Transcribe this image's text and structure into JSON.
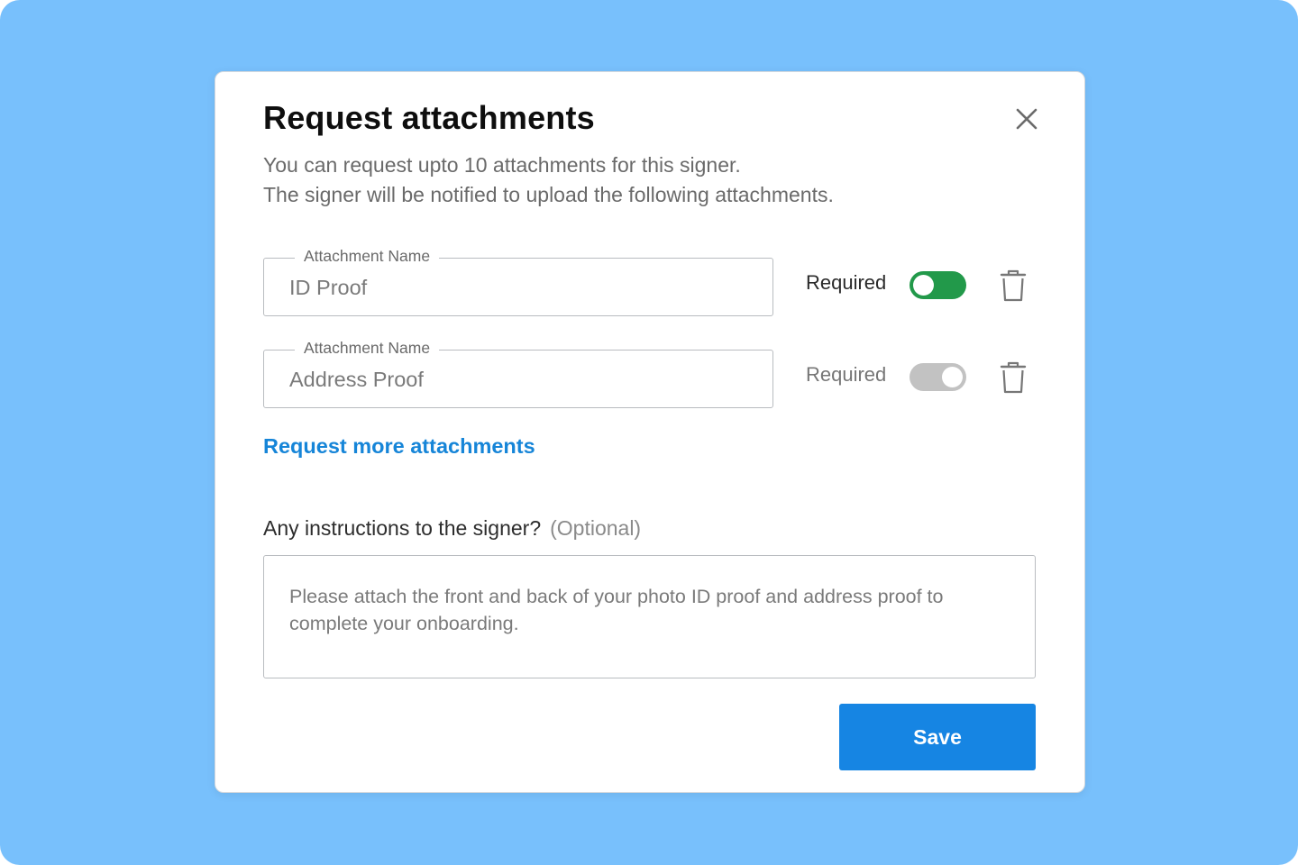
{
  "dialog": {
    "title": "Request attachments",
    "subtitle_line1": "You can request upto 10 attachments for this signer.",
    "subtitle_line2": "The signer will be notified to upload the following attachments.",
    "close_icon": "close-icon"
  },
  "attachments": [
    {
      "field_label": "Attachment Name",
      "value": "ID Proof",
      "required_label": "Required",
      "required": true,
      "delete_icon": "trash-icon"
    },
    {
      "field_label": "Attachment Name",
      "value": "Address Proof",
      "required_label": "Required",
      "required": false,
      "delete_icon": "trash-icon"
    }
  ],
  "request_more_link": "Request more attachments",
  "instructions": {
    "label": "Any instructions to the signer?",
    "optional_tag": "(Optional)",
    "text": "Please attach the front and back of your photo ID proof and address proof to complete your onboarding."
  },
  "save_button": "Save",
  "colors": {
    "backdrop": "#78c0fc",
    "accent": "#1685e3",
    "link": "#1685d8",
    "toggle_on": "#22994a",
    "toggle_off": "#c2c2c2"
  }
}
